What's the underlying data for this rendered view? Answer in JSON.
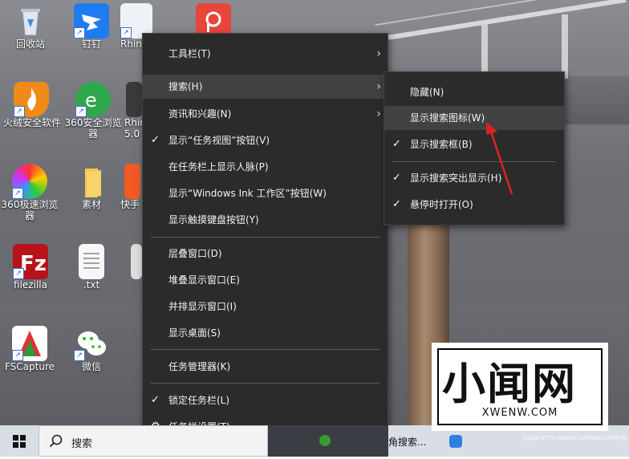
{
  "desktop": {
    "icons": [
      {
        "label": "回收站"
      },
      {
        "label": "钉钉"
      },
      {
        "label": "Rhin"
      },
      {
        "label": "火绒安全软件"
      },
      {
        "label": "360安全浏览"
      },
      {
        "label": "器"
      },
      {
        "label": "Rhin"
      },
      {
        "label": "5.0"
      },
      {
        "label": "360极速浏览"
      },
      {
        "label": "器"
      },
      {
        "label": "素材"
      },
      {
        "label": "快手"
      },
      {
        "label": "filezilla"
      },
      {
        "label": ".txt"
      },
      {
        "label": "FSCapture"
      },
      {
        "label": "微信"
      }
    ]
  },
  "context_menu": {
    "items": [
      {
        "label": "工具栏(T)"
      },
      {
        "label": "搜索(H)"
      },
      {
        "label": "资讯和兴趣(N)"
      },
      {
        "label": "显示“任务视图”按钮(V)"
      },
      {
        "label": "在任务栏上显示人脉(P)"
      },
      {
        "label": "显示“Windows Ink 工作区”按钮(W)"
      },
      {
        "label": "显示触摸键盘按钮(Y)"
      },
      {
        "label": "层叠窗口(D)"
      },
      {
        "label": "堆叠显示窗口(E)"
      },
      {
        "label": "并排显示窗口(I)"
      },
      {
        "label": "显示桌面(S)"
      },
      {
        "label": "任务管理器(K)"
      },
      {
        "label": "锁定任务栏(L)"
      },
      {
        "label": "任务栏设置(T)"
      }
    ]
  },
  "submenu": {
    "items": [
      {
        "label": "隐藏(N)"
      },
      {
        "label": "显示搜索图标(W)"
      },
      {
        "label": "显示搜索框(B)"
      },
      {
        "label": "显示搜索突出显示(H)"
      },
      {
        "label": "悬停时打开(O)"
      }
    ]
  },
  "taskbar": {
    "search_label": "搜索",
    "partial_text": "角搜索..."
  },
  "watermark": {
    "big_text": "小闻网",
    "url": "XWENW.COM",
    "fine_print": "小闻网 HTTP://WWW.XWENW.COM专用"
  },
  "colors": {
    "menu_bg": "#2b2b2b",
    "menu_highlight": "#414141",
    "arrow": "#e02020"
  },
  "icons": [
    "recycle-bin-icon",
    "dingtalk-icon",
    "windows-start-icon",
    "search-icon",
    "gear-icon",
    "checkmark-icon",
    "chevron-right-icon"
  ]
}
